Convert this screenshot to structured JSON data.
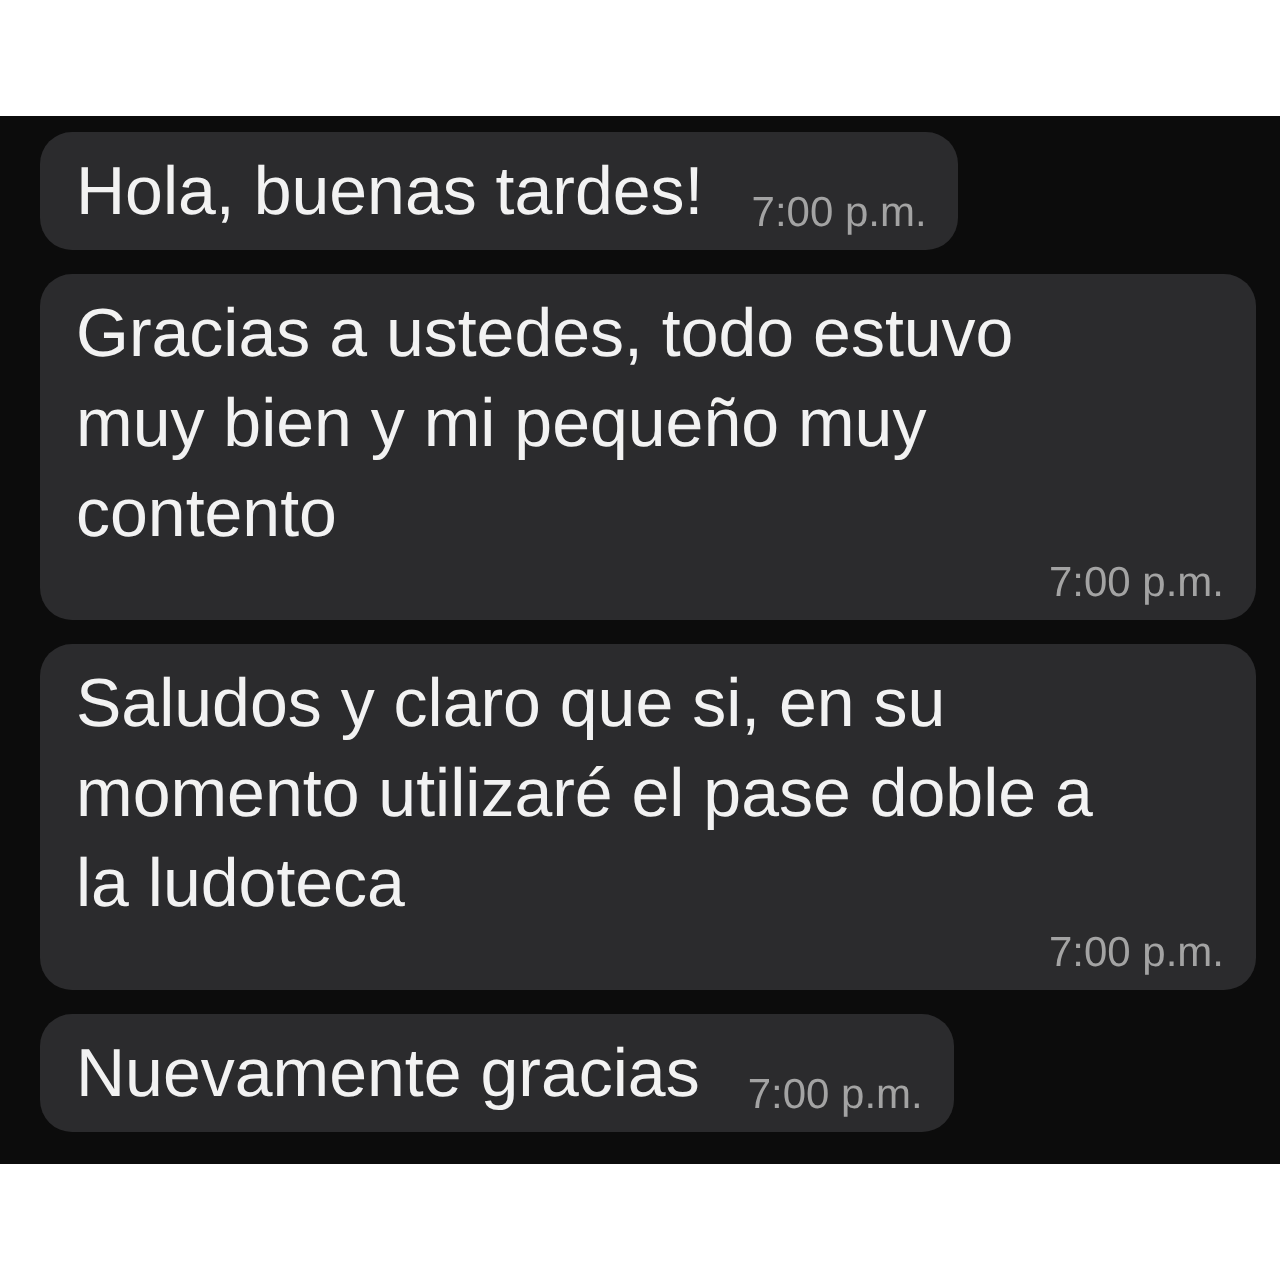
{
  "messages": [
    {
      "text": "Hola, buenas tardes!",
      "time": "7:00 p.m."
    },
    {
      "text": "Gracias a ustedes, todo estuvo\nmuy bien y mi pequeño muy\ncontento",
      "time": "7:00 p.m."
    },
    {
      "text": "Saludos y claro que si, en su\nmomento utilizaré el pase doble a\nla ludoteca",
      "time": "7:00 p.m."
    },
    {
      "text": "Nuevamente gracias",
      "time": "7:00 p.m."
    }
  ]
}
